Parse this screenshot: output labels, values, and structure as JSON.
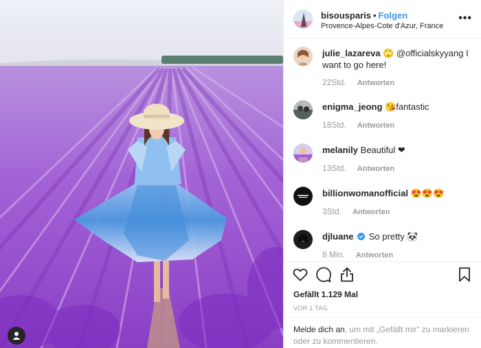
{
  "post": {
    "username": "bisousparis",
    "separator": "•",
    "follow_label": "Folgen",
    "location": "Provence-Alpes-Cote d'Azur, France",
    "more_label": "•••"
  },
  "comments": [
    {
      "username": "julie_lazareva",
      "text": "🙄 @officialskyyang I want to go here!",
      "time": "22Std.",
      "reply_label": "Antworten"
    },
    {
      "username": "enigma_jeong",
      "text": "😘fantastic",
      "time": "18Std.",
      "reply_label": "Antworten"
    },
    {
      "username": "melanily",
      "text": "Beautiful ❤",
      "time": "13Std.",
      "reply_label": "Antworten"
    },
    {
      "username": "billionwomanofficial",
      "text": "😍😍😍",
      "time": "3Std.",
      "reply_label": "Antworten"
    },
    {
      "username": "djluane",
      "text": "So pretty 🐼",
      "time": "8 Min.",
      "reply_label": "Antworten",
      "verified": true
    }
  ],
  "likes": "Gefällt 1.129 Mal",
  "time_ago": "VOR 1 TAG",
  "login": {
    "link": "Melde dich an",
    "text": ", um mit „Gefällt mir“ zu markieren oder zu kommentieren."
  },
  "icons": {
    "like": "heart-icon",
    "comment": "comment-icon",
    "share": "share-icon",
    "save": "bookmark-icon",
    "user_tag": "user-icon",
    "verified": "verified-badge-icon"
  },
  "colors": {
    "follow": "#3897f0",
    "verified": "#3897f0",
    "muted": "#999999",
    "text": "#262626",
    "lavender": "#a46ad8"
  }
}
